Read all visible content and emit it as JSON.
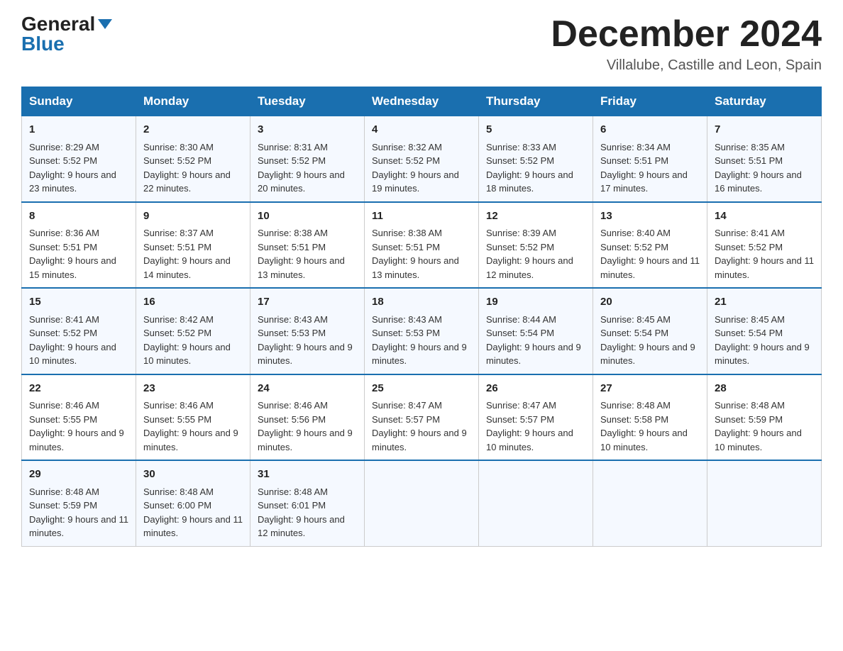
{
  "header": {
    "logo_general": "General",
    "logo_blue": "Blue",
    "month_title": "December 2024",
    "location": "Villalube, Castille and Leon, Spain"
  },
  "days_of_week": [
    "Sunday",
    "Monday",
    "Tuesday",
    "Wednesday",
    "Thursday",
    "Friday",
    "Saturday"
  ],
  "weeks": [
    [
      {
        "day": "1",
        "sunrise": "8:29 AM",
        "sunset": "5:52 PM",
        "daylight": "9 hours and 23 minutes."
      },
      {
        "day": "2",
        "sunrise": "8:30 AM",
        "sunset": "5:52 PM",
        "daylight": "9 hours and 22 minutes."
      },
      {
        "day": "3",
        "sunrise": "8:31 AM",
        "sunset": "5:52 PM",
        "daylight": "9 hours and 20 minutes."
      },
      {
        "day": "4",
        "sunrise": "8:32 AM",
        "sunset": "5:52 PM",
        "daylight": "9 hours and 19 minutes."
      },
      {
        "day": "5",
        "sunrise": "8:33 AM",
        "sunset": "5:52 PM",
        "daylight": "9 hours and 18 minutes."
      },
      {
        "day": "6",
        "sunrise": "8:34 AM",
        "sunset": "5:51 PM",
        "daylight": "9 hours and 17 minutes."
      },
      {
        "day": "7",
        "sunrise": "8:35 AM",
        "sunset": "5:51 PM",
        "daylight": "9 hours and 16 minutes."
      }
    ],
    [
      {
        "day": "8",
        "sunrise": "8:36 AM",
        "sunset": "5:51 PM",
        "daylight": "9 hours and 15 minutes."
      },
      {
        "day": "9",
        "sunrise": "8:37 AM",
        "sunset": "5:51 PM",
        "daylight": "9 hours and 14 minutes."
      },
      {
        "day": "10",
        "sunrise": "8:38 AM",
        "sunset": "5:51 PM",
        "daylight": "9 hours and 13 minutes."
      },
      {
        "day": "11",
        "sunrise": "8:38 AM",
        "sunset": "5:51 PM",
        "daylight": "9 hours and 13 minutes."
      },
      {
        "day": "12",
        "sunrise": "8:39 AM",
        "sunset": "5:52 PM",
        "daylight": "9 hours and 12 minutes."
      },
      {
        "day": "13",
        "sunrise": "8:40 AM",
        "sunset": "5:52 PM",
        "daylight": "9 hours and 11 minutes."
      },
      {
        "day": "14",
        "sunrise": "8:41 AM",
        "sunset": "5:52 PM",
        "daylight": "9 hours and 11 minutes."
      }
    ],
    [
      {
        "day": "15",
        "sunrise": "8:41 AM",
        "sunset": "5:52 PM",
        "daylight": "9 hours and 10 minutes."
      },
      {
        "day": "16",
        "sunrise": "8:42 AM",
        "sunset": "5:52 PM",
        "daylight": "9 hours and 10 minutes."
      },
      {
        "day": "17",
        "sunrise": "8:43 AM",
        "sunset": "5:53 PM",
        "daylight": "9 hours and 9 minutes."
      },
      {
        "day": "18",
        "sunrise": "8:43 AM",
        "sunset": "5:53 PM",
        "daylight": "9 hours and 9 minutes."
      },
      {
        "day": "19",
        "sunrise": "8:44 AM",
        "sunset": "5:54 PM",
        "daylight": "9 hours and 9 minutes."
      },
      {
        "day": "20",
        "sunrise": "8:45 AM",
        "sunset": "5:54 PM",
        "daylight": "9 hours and 9 minutes."
      },
      {
        "day": "21",
        "sunrise": "8:45 AM",
        "sunset": "5:54 PM",
        "daylight": "9 hours and 9 minutes."
      }
    ],
    [
      {
        "day": "22",
        "sunrise": "8:46 AM",
        "sunset": "5:55 PM",
        "daylight": "9 hours and 9 minutes."
      },
      {
        "day": "23",
        "sunrise": "8:46 AM",
        "sunset": "5:55 PM",
        "daylight": "9 hours and 9 minutes."
      },
      {
        "day": "24",
        "sunrise": "8:46 AM",
        "sunset": "5:56 PM",
        "daylight": "9 hours and 9 minutes."
      },
      {
        "day": "25",
        "sunrise": "8:47 AM",
        "sunset": "5:57 PM",
        "daylight": "9 hours and 9 minutes."
      },
      {
        "day": "26",
        "sunrise": "8:47 AM",
        "sunset": "5:57 PM",
        "daylight": "9 hours and 10 minutes."
      },
      {
        "day": "27",
        "sunrise": "8:48 AM",
        "sunset": "5:58 PM",
        "daylight": "9 hours and 10 minutes."
      },
      {
        "day": "28",
        "sunrise": "8:48 AM",
        "sunset": "5:59 PM",
        "daylight": "9 hours and 10 minutes."
      }
    ],
    [
      {
        "day": "29",
        "sunrise": "8:48 AM",
        "sunset": "5:59 PM",
        "daylight": "9 hours and 11 minutes."
      },
      {
        "day": "30",
        "sunrise": "8:48 AM",
        "sunset": "6:00 PM",
        "daylight": "9 hours and 11 minutes."
      },
      {
        "day": "31",
        "sunrise": "8:48 AM",
        "sunset": "6:01 PM",
        "daylight": "9 hours and 12 minutes."
      },
      null,
      null,
      null,
      null
    ]
  ]
}
